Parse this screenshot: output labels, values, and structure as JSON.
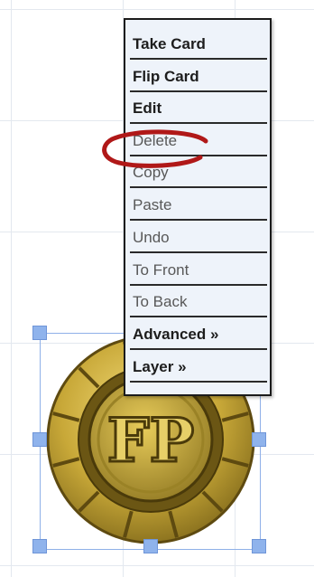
{
  "context_menu": {
    "items": [
      {
        "label": "Take Card",
        "style": "bold"
      },
      {
        "label": "Flip Card",
        "style": "bold"
      },
      {
        "label": "Edit",
        "style": "bold"
      },
      {
        "label": "Delete",
        "style": "light",
        "highlighted": true
      },
      {
        "label": "Copy",
        "style": "light"
      },
      {
        "label": "Paste",
        "style": "light"
      },
      {
        "label": "Undo",
        "style": "light"
      },
      {
        "label": "To Front",
        "style": "light"
      },
      {
        "label": "To Back",
        "style": "light"
      },
      {
        "label": "Advanced »",
        "style": "bold"
      },
      {
        "label": "Layer »",
        "style": "bold"
      }
    ]
  },
  "token": {
    "logo_text": "FP",
    "selected": true
  },
  "colors": {
    "menu_background": "#eef3fa",
    "menu_border": "#1b1b1b",
    "highlight_circle": "#b01818",
    "selection": "#8fb3ec",
    "token_gold": "#c8a838",
    "grid": "#e3e8ef"
  }
}
